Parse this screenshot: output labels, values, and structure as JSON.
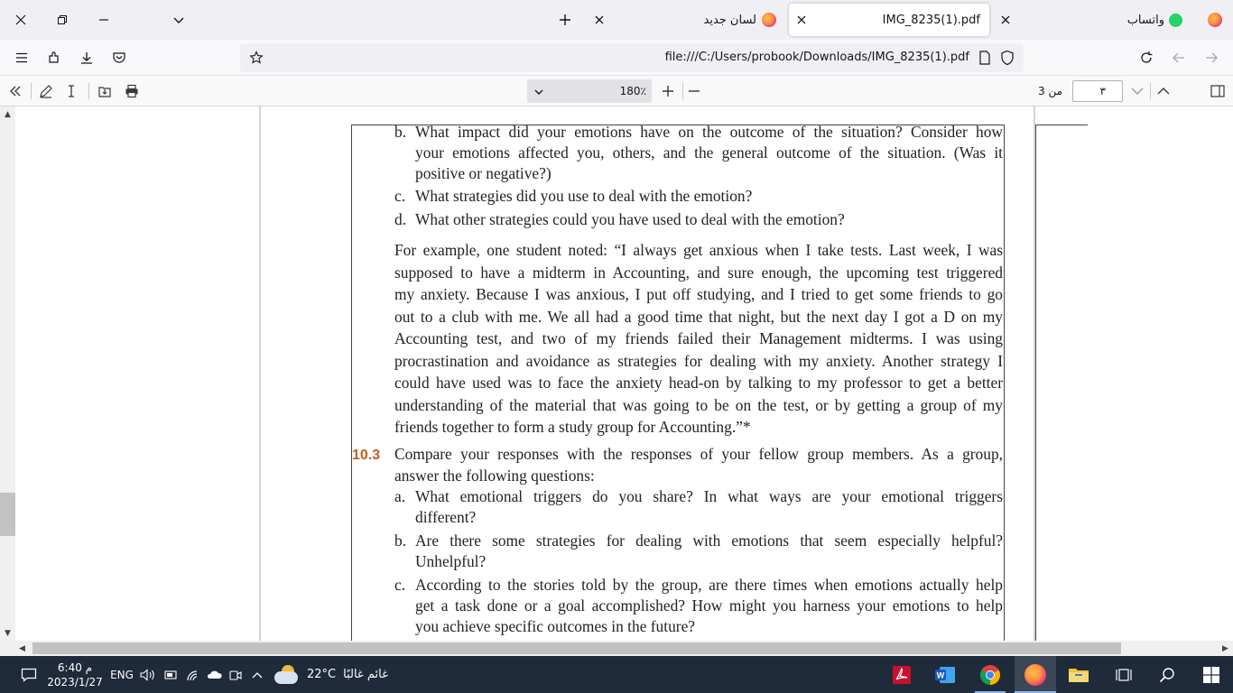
{
  "tabs": {
    "whatsapp_label": "واتساب",
    "pdf_label": "IMG_8235(1).pdf",
    "newtab_label": "لسان جديد"
  },
  "nav": {
    "url": "file:///C:/Users/probook/Downloads/IMG_8235(1).pdf"
  },
  "pdf_toolbar": {
    "zoom": "180٪",
    "page_number": "٣",
    "page_of": "من 3"
  },
  "document": {
    "item_b_lines": [
      "b.",
      "What impact did your emotions have on the outcome of the situation? Consider how",
      "your emotions affected you, others, and the general outcome of the situation. (Was it",
      "positive or negative?)"
    ],
    "item_c": {
      "letter": "c.",
      "text": "What strategies did you use to deal with the emotion?"
    },
    "item_d": {
      "letter": "d.",
      "text": "What other strategies could you have used to deal with the emotion?"
    },
    "example_lines": [
      "For example, one student noted: “I always get anxious when I take tests. Last week, I was",
      "supposed to have a midterm in Accounting, and sure enough, the upcoming test triggered",
      "my anxiety. Because I was anxious, I put off studying, and I tried to get some friends to go",
      "out to a club with me. We all had a good time that night, but the next day I got a D on my",
      "Accounting test, and two of my friends failed their Management midterms. I was using",
      "procrastination and avoidance as strategies for dealing with my anxiety. Another strategy I",
      "could have used was to face the anxiety head-on by talking to my professor to get a better",
      "understanding of the material that was going to be on the test, or by getting a group of my",
      "friends together to form a study group for Accounting.”*"
    ],
    "section_number": "10.3",
    "section_lines": [
      "Compare your responses with the responses of your fellow group members. As a group,",
      "answer the following questions:"
    ],
    "q_a": {
      "letter": "a.",
      "lines": [
        "What emotional triggers do you share? In what ways are your emotional triggers",
        "different?"
      ]
    },
    "q_b": {
      "letter": "b.",
      "lines": [
        "Are there some strategies for dealing with emotions that seem especially helpful?",
        "Unhelpful?"
      ]
    },
    "q_c": {
      "letter": "c.",
      "lines": [
        "According to the stories told by the group, are there times when emotions actually help",
        "get a task done or a goal accomplished? How might you harness your emotions to help",
        "you achieve specific outcomes in the future?"
      ]
    }
  },
  "taskbar": {
    "time": "6:40 م",
    "date": "2023/1/27",
    "language": "ENG",
    "temperature": "22°C",
    "weather": "غائم غالبًا"
  },
  "colors": {
    "section_number": "#c0621b",
    "taskbar": "#1f2a3a"
  }
}
